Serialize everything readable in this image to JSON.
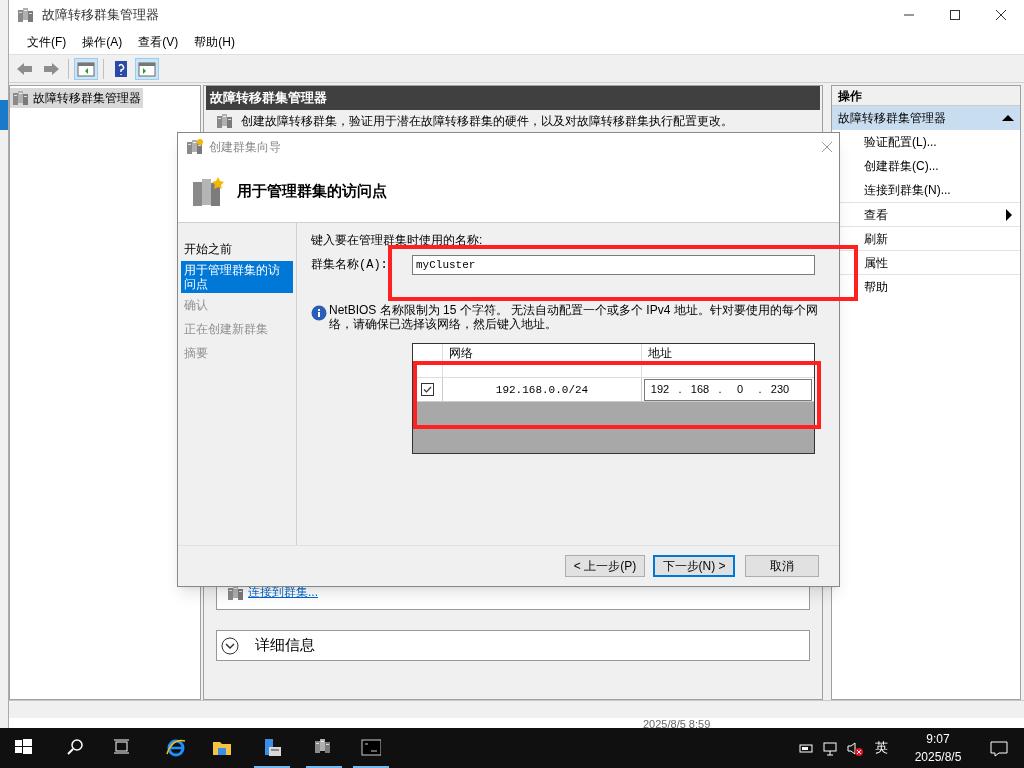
{
  "window": {
    "title": "故障转移群集管理器",
    "menu": [
      "文件(F)",
      "操作(A)",
      "查看(V)",
      "帮助(H)"
    ]
  },
  "toolbar": [
    {
      "kind": "back"
    },
    {
      "kind": "forward"
    },
    {
      "kind": "tree_pane",
      "pressed": true
    },
    {
      "kind": "help"
    },
    {
      "kind": "action_pane",
      "pressed": true
    }
  ],
  "tree": {
    "items": [
      {
        "label": "故障转移群集管理器",
        "selected": true
      }
    ]
  },
  "center": {
    "header": "故障转移群集管理器",
    "description": "创建故障转移群集，验证用于潜在故障转移群集的硬件，以及对故障转移群集执行配置更改。",
    "link": "连接到群集...",
    "details": "详细信息"
  },
  "actions": {
    "title": "操作",
    "section": "故障转移群集管理器",
    "expanded": true,
    "items": [
      {
        "label": "验证配置(L)...",
        "kind": "command"
      },
      {
        "label": "创建群集(C)...",
        "kind": "command"
      },
      {
        "label": "连接到群集(N)...",
        "kind": "command"
      },
      {
        "label": "查看",
        "kind": "submenu"
      },
      {
        "label": "刷新",
        "kind": "command"
      },
      {
        "label": "属性",
        "kind": "command"
      },
      {
        "label": "帮助",
        "kind": "command"
      }
    ]
  },
  "dialog": {
    "title": "创建群集向导",
    "heading": "用于管理群集的访问点",
    "steps": [
      {
        "label": "开始之前",
        "selected": false,
        "disabled": false
      },
      {
        "label": "用于管理群集的访问点",
        "selected": true,
        "disabled": false
      },
      {
        "label": "确认",
        "selected": false,
        "disabled": true
      },
      {
        "label": "正在创建新群集",
        "selected": false,
        "disabled": true
      },
      {
        "label": "摘要",
        "selected": false,
        "disabled": true
      }
    ],
    "prompt": "键入要在管理群集时使用的名称:",
    "name_label": "群集名称(A):",
    "name_value": "myCluster",
    "info": "NetBIOS 名称限制为 15 个字符。 无法自动配置一个或多个 IPv4 地址。针对要使用的每个网络，请确保已选择该网络，然后键入地址。",
    "name_highlighted": true,
    "networks": {
      "columns": [
        "网络",
        "地址"
      ],
      "rows": [
        {
          "checked": true,
          "highlighted": true,
          "network": "192.168.0.0/24",
          "address": [
            "192",
            ".",
            "168",
            ".",
            "0",
            ".",
            "230"
          ]
        }
      ]
    },
    "buttons": [
      {
        "label": "< 上一步(P)",
        "default": false
      },
      {
        "label": "下一步(N) >",
        "default": true
      },
      {
        "label": "取消",
        "default": false
      }
    ]
  },
  "status_bar": {
    "text": "2025/8/5 8:59"
  },
  "taskbar": {
    "apps": [
      {
        "kind": "start",
        "running": false
      },
      {
        "kind": "search",
        "running": false
      },
      {
        "kind": "task_view",
        "running": false
      },
      {
        "kind": "browser",
        "running": false
      },
      {
        "kind": "folder",
        "running": false
      },
      {
        "kind": "server_manager",
        "running": true
      },
      {
        "kind": "cluster",
        "running": true
      },
      {
        "kind": "console",
        "running": true
      }
    ],
    "ime": "英",
    "time": "9:07",
    "date": "2025/8/5"
  }
}
